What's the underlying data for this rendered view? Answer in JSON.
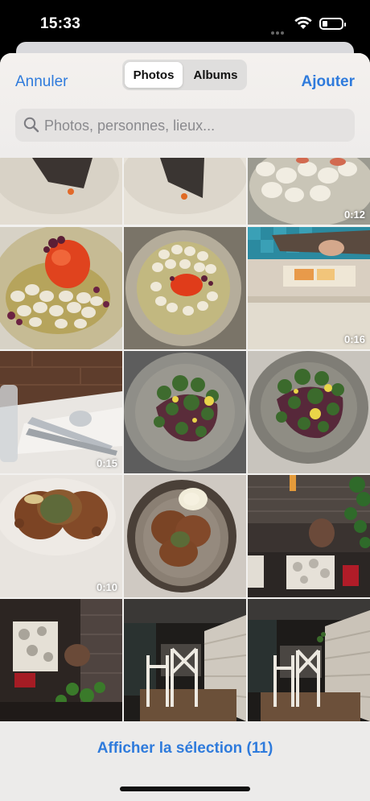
{
  "status_bar": {
    "time": "15:33"
  },
  "header": {
    "cancel_label": "Annuler",
    "add_label": "Ajouter",
    "tabs": [
      {
        "label": "Photos",
        "active": true
      },
      {
        "label": "Albums",
        "active": false
      }
    ]
  },
  "search": {
    "placeholder": "Photos, personnes, lieux..."
  },
  "photos": [
    {
      "duration": ""
    },
    {
      "duration": ""
    },
    {
      "duration": "0:12"
    },
    {
      "duration": ""
    },
    {
      "duration": ""
    },
    {
      "duration": "0:16"
    },
    {
      "duration": "0:15"
    },
    {
      "duration": ""
    },
    {
      "duration": ""
    },
    {
      "duration": "0:10"
    },
    {
      "duration": ""
    },
    {
      "duration": ""
    },
    {
      "duration": ""
    },
    {
      "duration": ""
    },
    {
      "duration": ""
    }
  ],
  "footer": {
    "selection_label": "Afficher la sélection (11)"
  },
  "colors": {
    "accent": "#2f7bdc"
  }
}
